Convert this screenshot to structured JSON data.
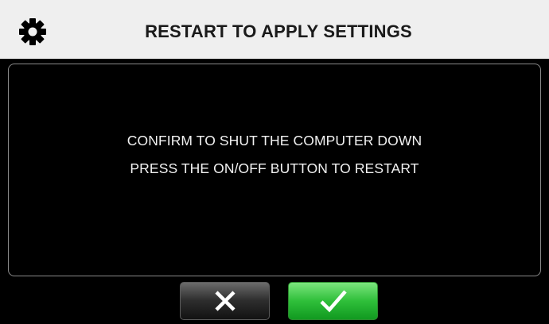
{
  "header": {
    "title": "RESTART TO APPLY SETTINGS",
    "icon": "gear-icon"
  },
  "dialog": {
    "line1": "CONFIRM TO SHUT THE COMPUTER DOWN",
    "line2": "PRESS THE ON/OFF BUTTON TO RESTART"
  },
  "buttons": {
    "cancel": {
      "icon": "close-icon",
      "color": "#2e2e2e"
    },
    "confirm": {
      "icon": "check-icon",
      "color": "#2fbf3a"
    }
  }
}
